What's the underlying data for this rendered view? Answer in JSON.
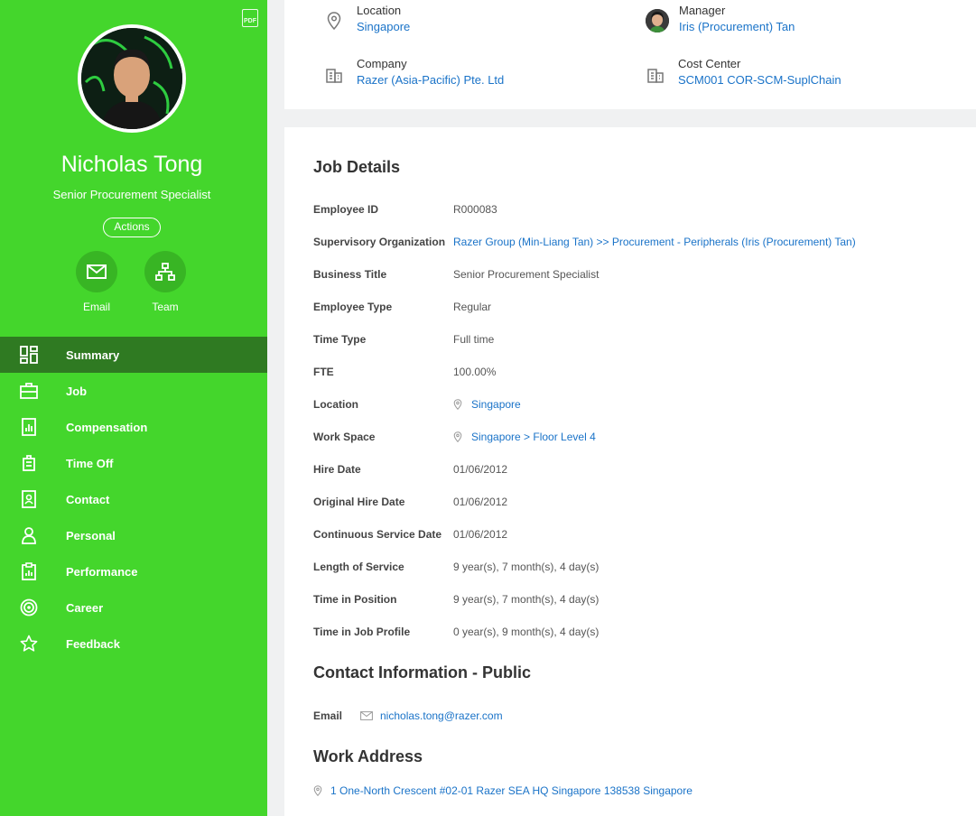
{
  "profile": {
    "pdf_label": "PDF",
    "name": "Nicholas Tong",
    "title": "Senior Procurement Specialist",
    "actions_label": "Actions",
    "email_label": "Email",
    "team_label": "Team"
  },
  "nav": [
    {
      "label": "Summary",
      "icon": "dashboard-icon"
    },
    {
      "label": "Job",
      "icon": "briefcase-icon"
    },
    {
      "label": "Compensation",
      "icon": "chart-icon"
    },
    {
      "label": "Time Off",
      "icon": "luggage-icon"
    },
    {
      "label": "Contact",
      "icon": "contact-card-icon"
    },
    {
      "label": "Personal",
      "icon": "person-icon"
    },
    {
      "label": "Performance",
      "icon": "clipboard-icon"
    },
    {
      "label": "Career",
      "icon": "target-icon"
    },
    {
      "label": "Feedback",
      "icon": "star-icon"
    }
  ],
  "header": {
    "location_label": "Location",
    "location_value": "Singapore",
    "manager_label": "Manager",
    "manager_value": "Iris (Procurement) Tan",
    "company_label": "Company",
    "company_value": "Razer (Asia-Pacific) Pte. Ltd",
    "cost_center_label": "Cost Center",
    "cost_center_value": "SCM001 COR-SCM-SuplChain"
  },
  "job": {
    "heading": "Job Details",
    "rows": [
      {
        "k": "Employee ID",
        "v": "R000083"
      },
      {
        "k": "Supervisory Organization",
        "v": "Razer Group (Min-Liang Tan) >> Procurement - Peripherals (Iris (Procurement) Tan)"
      },
      {
        "k": "Business Title",
        "v": "Senior Procurement Specialist"
      },
      {
        "k": "Employee Type",
        "v": "Regular"
      },
      {
        "k": "Time Type",
        "v": "Full time"
      },
      {
        "k": "FTE",
        "v": "100.00%"
      },
      {
        "k": "Location",
        "v": "Singapore"
      },
      {
        "k": "Work Space",
        "v": "Singapore > Floor Level 4"
      },
      {
        "k": "Hire Date",
        "v": "01/06/2012"
      },
      {
        "k": "Original Hire Date",
        "v": "01/06/2012"
      },
      {
        "k": "Continuous Service Date",
        "v": "01/06/2012"
      },
      {
        "k": "Length of Service",
        "v": "9 year(s), 7 month(s), 4 day(s)"
      },
      {
        "k": "Time in Position",
        "v": "9 year(s), 7 month(s), 4 day(s)"
      },
      {
        "k": "Time in Job Profile",
        "v": "0 year(s), 9 month(s), 4 day(s)"
      }
    ]
  },
  "contact": {
    "heading": "Contact Information - Public",
    "email_label": "Email",
    "email_value": "nicholas.tong@razer.com"
  },
  "work_address": {
    "heading": "Work Address",
    "value": "1 One-North Crescent #02-01 Razer SEA HQ Singapore 138538 Singapore"
  }
}
